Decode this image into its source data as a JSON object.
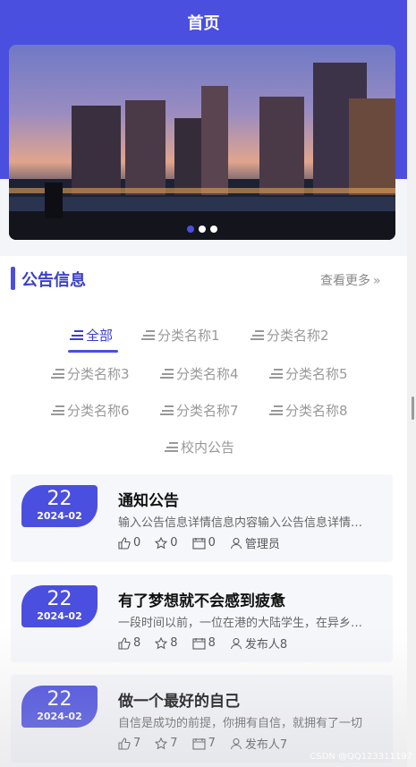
{
  "header": {
    "title": "首页"
  },
  "banner": {
    "dots": 3,
    "active_dot": 0
  },
  "notice": {
    "title": "公告信息",
    "more_label": "查看更多",
    "more_icon": "double-chevron-right-icon",
    "tabs": [
      {
        "label": "全部",
        "active": true
      },
      {
        "label": "分类名称1"
      },
      {
        "label": "分类名称2"
      },
      {
        "label": "分类名称3"
      },
      {
        "label": "分类名称4"
      },
      {
        "label": "分类名称5"
      },
      {
        "label": "分类名称6"
      },
      {
        "label": "分类名称7"
      },
      {
        "label": "分类名称8"
      },
      {
        "label": "校内公告"
      }
    ],
    "items": [
      {
        "day": "22",
        "ym": "2024-02",
        "title": "通知公告",
        "desc": "输入公告信息详情信息内容输入公告信息详情信息内容",
        "likes": "0",
        "favorites": "0",
        "views": "0",
        "author": "管理员"
      },
      {
        "day": "22",
        "ym": "2024-02",
        "title": "有了梦想就不会感到疲惫",
        "desc": "一段时间以前，一位在港的大陆学生，在异乡求学",
        "likes": "8",
        "favorites": "8",
        "views": "8",
        "author": "发布人8"
      },
      {
        "day": "22",
        "ym": "2024-02",
        "title": "做一个最好的自己",
        "desc": "自信是成功的前提，你拥有自信，就拥有了一切",
        "likes": "7",
        "favorites": "7",
        "views": "7",
        "author": "发布人7"
      }
    ]
  },
  "watermark": "CSDN @QQ123311197",
  "colors": {
    "primary": "#4b4fe0",
    "title_blue": "#3b40c9"
  }
}
